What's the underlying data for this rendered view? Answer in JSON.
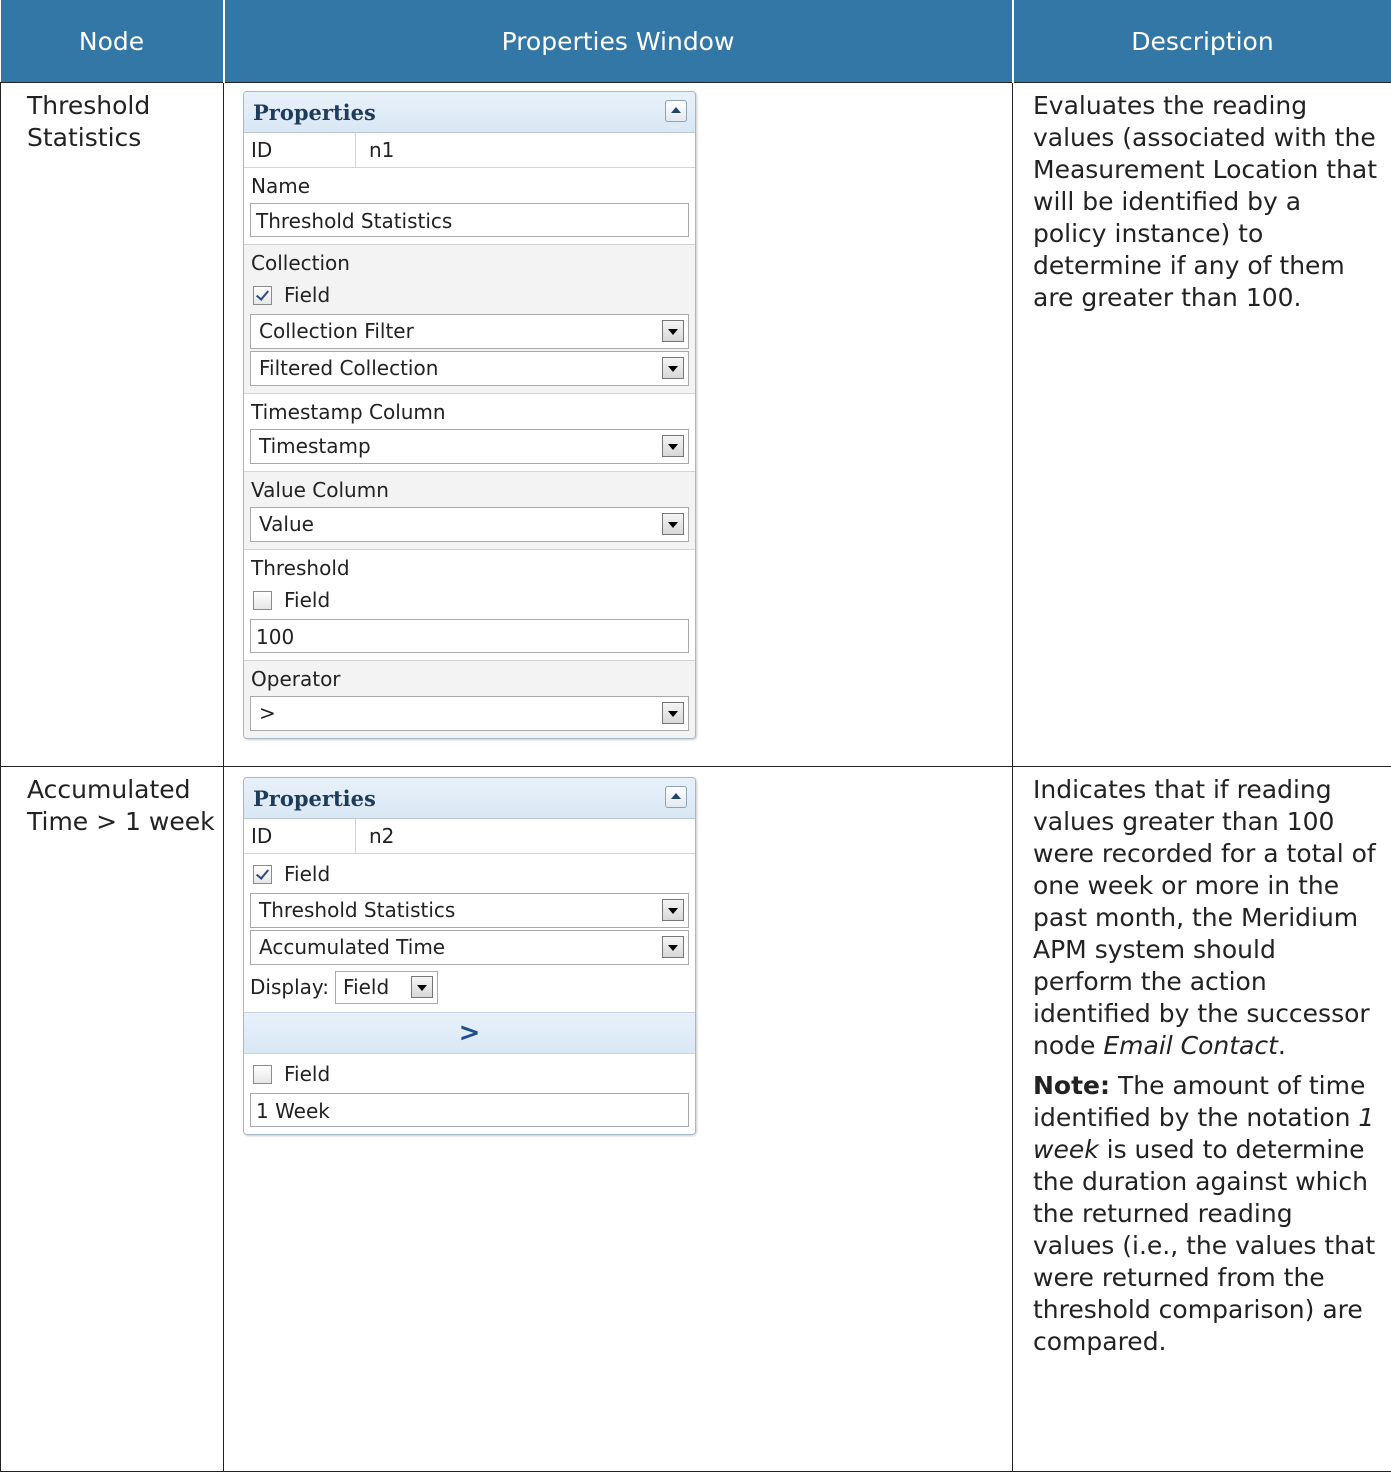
{
  "headers": {
    "node": "Node",
    "properties": "Properties Window",
    "description": "Description"
  },
  "rows": [
    {
      "node": "Threshold Statistics",
      "panel": {
        "title": "Properties",
        "id_label": "ID",
        "id_value": "n1",
        "name_label": "Name",
        "name_value": "Threshold Statistics",
        "collection_label": "Collection",
        "collection_field_label": "Field",
        "collection_field_checked": true,
        "collection_filter": "Collection Filter",
        "filtered_collection": "Filtered Collection",
        "timestamp_label": "Timestamp Column",
        "timestamp_value": "Timestamp",
        "value_label": "Value Column",
        "value_value": "Value",
        "threshold_label": "Threshold",
        "threshold_field_label": "Field",
        "threshold_field_checked": false,
        "threshold_value": "100",
        "operator_label": "Operator",
        "operator_value": ">"
      },
      "description": "Evaluates the reading values (associated with the Measurement Location that will be identified by a policy instance) to determine if any of them are greater than 100."
    },
    {
      "node": "Accumulated Time > 1 week",
      "panel": {
        "title": "Properties",
        "id_label": "ID",
        "id_value": "n2",
        "field_label": "Field",
        "field_checked": true,
        "source_node": "Threshold Statistics",
        "source_output": "Accumulated Time",
        "display_label": "Display:",
        "display_value": "Field",
        "operator": ">",
        "field2_label": "Field",
        "field2_checked": false,
        "compare_value": "1 Week"
      },
      "description": {
        "main_before": "Indicates that if reading values greater than 100 were recorded for a total of one week or more in the past month, the Meridium APM system should perform the action identified by the successor node ",
        "main_italic": "Email Contact",
        "main_after": ".",
        "note_label": "Note:",
        "note_before": " The amount of time identified by the notation ",
        "note_italic": "1 week",
        "note_after": " is used to determine the duration against which the returned reading values (i.e., the values that were returned from the threshold comparison) are compared."
      }
    }
  ],
  "colors": {
    "header_bg": "#3277a6",
    "header_text": "#ffffff",
    "panel_header": "#d9e7f4"
  }
}
